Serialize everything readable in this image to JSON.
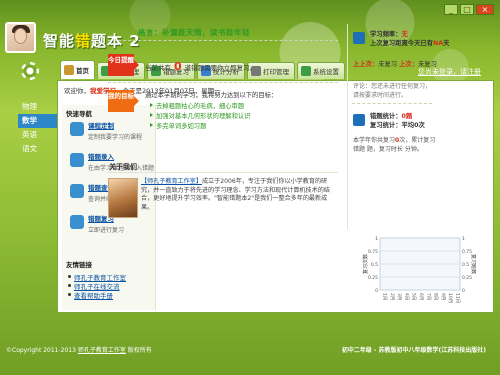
{
  "app": {
    "title_pre": "智能",
    "title_hi": "错",
    "title_post": "题本",
    "version": "2"
  },
  "window_controls": {
    "minimize": "_",
    "maximize": "□",
    "close": "×"
  },
  "header": {
    "register_link": "您尚未登录，请注册"
  },
  "tabs": [
    {
      "label": "首页",
      "icon": "home-icon",
      "color": "#c99830",
      "active": true
    },
    {
      "label": "错题管理",
      "icon": "notebook-icon",
      "color": "#3c9d44"
    },
    {
      "label": "错题复习",
      "icon": "review-icon",
      "color": "#3c9d44"
    },
    {
      "label": "统计分析",
      "icon": "chart-icon",
      "color": "#3a7fcf"
    },
    {
      "label": "打印管理",
      "icon": "printer-icon",
      "color": "#777777"
    },
    {
      "label": "系统设置",
      "icon": "settings-icon",
      "color": "#3c9d44"
    }
  ],
  "subjects": [
    {
      "label": "物理",
      "active": false
    },
    {
      "label": "数学",
      "active": true
    },
    {
      "label": "英语",
      "active": false
    },
    {
      "label": "语文",
      "active": false
    }
  ],
  "welcome": {
    "prefix": "欢迎你，",
    "user": "我爱学习",
    "suffix": "，今天是2013年01月07日，星期一"
  },
  "quick_nav": {
    "heading": "快速导航",
    "items": [
      {
        "title": "课程定制",
        "desc": "定制我要学习的课程",
        "icon": "course-icon"
      },
      {
        "title": "错题录入",
        "desc": "在由学习课程中录入错题",
        "icon": "entry-icon"
      },
      {
        "title": "错题查询",
        "desc": "查询并编辑错题",
        "icon": "query-icon"
      },
      {
        "title": "错题复习",
        "desc": "立即进行复习",
        "icon": "review-icon"
      }
    ]
  },
  "friend_links": {
    "heading": "友情链接",
    "items": [
      "师孔子教育工作室",
      "师孔子在线交流",
      "查看帮助手册"
    ]
  },
  "quote": "格言：补漏趁天晴，读书趁年轻",
  "today": {
    "tag": "今日提醒",
    "text_pre": "当前共有",
    "count": "0",
    "text_post": "道错题需要你立即复习。"
  },
  "goal": {
    "tag": "我的目标",
    "intro": "通过本学期的学习，我将努力达到以下的目标：",
    "items": [
      "去掉粗题枯心的毛病，细心审题",
      "加强对基本几何形状的理解和认识",
      "多完单词多如习题"
    ]
  },
  "about": {
    "heading": "关于我们",
    "brand": "【师孔子教育工作室】",
    "text": "成立于2006年，专注于我们你以小学教育的研究，并一直致力于将先进的学习理念、学习方法和现代计算机技术的结合，更好地提升学习效率。\"智能错题本2\"是我们一整合多年的最新成果。"
  },
  "study_stats": {
    "icon": "stats-icon",
    "freq_label": "学习频率：",
    "freq_value": "无",
    "last_pre": "上次复习距离今天已有",
    "last_value": "NA",
    "last_post": "天",
    "last_review_label": "上上次：",
    "last_review_value": "未复习",
    "prev_label": "上次：",
    "prev_value": "未复习",
    "remark": "评论：您还未进行任何复习，请按要求时间进行。"
  },
  "error_stats": {
    "icon": "stats-icon",
    "count_label": "错题统计：",
    "count_value": "0题",
    "avg_label": "复习统计：",
    "avg_value": "平均0次",
    "week_pre": "本学年你共复习",
    "week_value": "0",
    "week_post": "次，累计复习错题 题，复习时长 分钟。"
  },
  "chart_data": {
    "type": "bar",
    "categories": [
      "1月",
      "2月",
      "3月",
      "4月",
      "5月",
      "6月",
      "7月",
      "8月",
      "9月",
      "10月",
      "11月"
    ],
    "values": [
      0,
      0,
      0,
      0,
      0,
      0,
      0,
      0,
      0,
      0,
      0
    ],
    "ylabel": "复习次数",
    "ylabel2": "复习题数",
    "yticks": [
      "1",
      "0.75",
      "0.5",
      "0.25",
      "0"
    ],
    "ylim": [
      0,
      1
    ],
    "grid": true
  },
  "footer": {
    "copyright_pre": "©Copyright 2011-2013 ",
    "copyright_link": "师孔子教育工作室",
    "copyright_post": " 版权所有",
    "product": "初中二年级 - 苏教版初中八年级数学(江苏科技出版社)"
  }
}
